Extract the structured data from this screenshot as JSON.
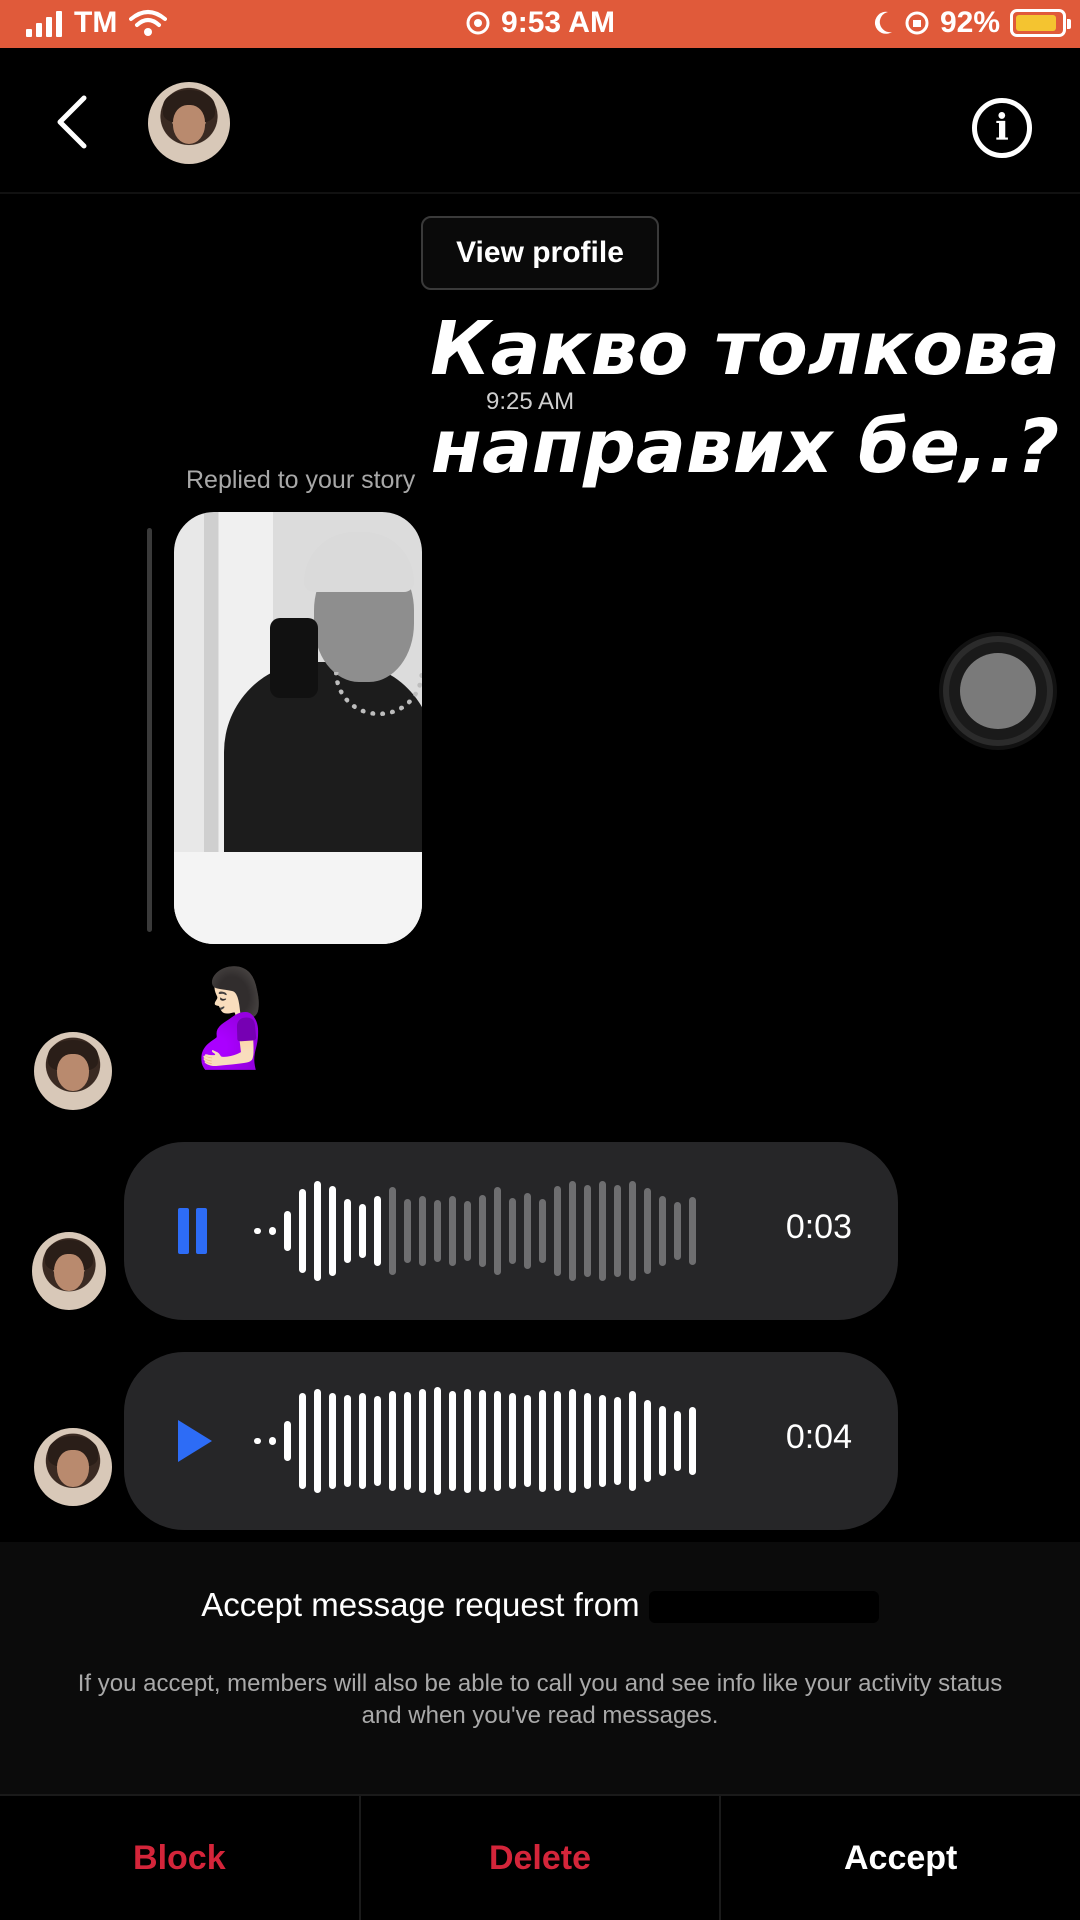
{
  "status_bar": {
    "carrier": "TM",
    "time": "9:53 AM",
    "battery": "92%"
  },
  "header": {
    "view_profile_label": "View profile"
  },
  "overlay_text": "Какво толкова направих бе,.?",
  "thread": {
    "timestamp": "9:25 AM",
    "replied_label": "Replied to your story",
    "emoji": "🤰🏻",
    "voice_messages": [
      {
        "duration": "0:03",
        "state": "playing"
      },
      {
        "duration": "0:04",
        "state": "paused"
      }
    ]
  },
  "request": {
    "title": "Accept message request from",
    "body": "If you accept, members will also be able to call you and see info like your activity status and when you've read messages."
  },
  "actions": {
    "block": "Block",
    "delete": "Delete",
    "accept": "Accept"
  },
  "colors": {
    "status_bar": "#e05a3a",
    "accent_blue": "#2d6cf6",
    "destructive_red": "#d4253a"
  }
}
